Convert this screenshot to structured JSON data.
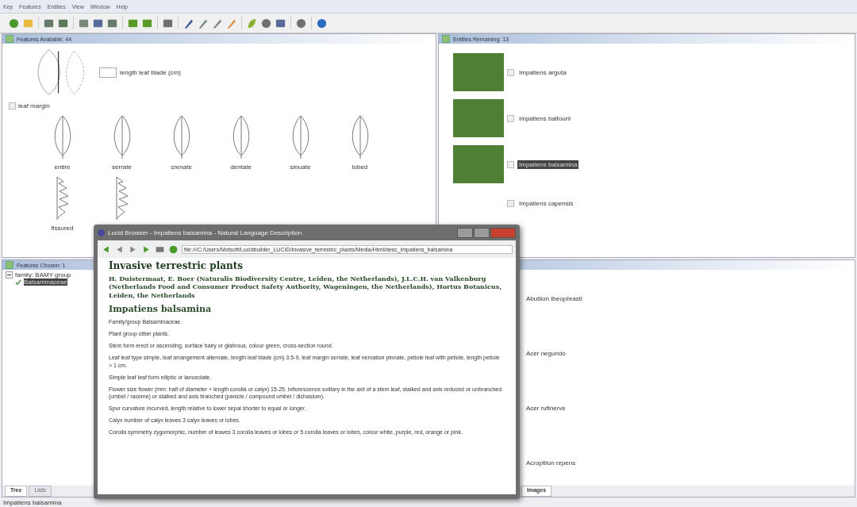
{
  "menu": [
    "Key",
    "Features",
    "Entities",
    "View",
    "Window",
    "Help"
  ],
  "features_available": {
    "title": "Features Available: 44",
    "length_field": {
      "label": "length leaf blade (cm)"
    },
    "leaf_margin": {
      "label": "leaf margin",
      "checked": false,
      "options": [
        {
          "label": "entire",
          "kind": "oval"
        },
        {
          "label": "serrate",
          "kind": "oval"
        },
        {
          "label": "crenate",
          "kind": "oval"
        },
        {
          "label": "dentate",
          "kind": "oval"
        },
        {
          "label": "sinuate",
          "kind": "oval"
        },
        {
          "label": "lobed",
          "kind": "oval"
        },
        {
          "label": "fissured",
          "kind": "fissured"
        },
        {
          "kind": "fissured"
        }
      ]
    }
  },
  "entities_remaining": {
    "title": "Entities Remaining: 13",
    "items": [
      {
        "name": "Impatiens arguta",
        "photo": true,
        "checked": false,
        "selected": false
      },
      {
        "name": "Impatiens balfourii",
        "photo": true,
        "checked": false,
        "selected": false
      },
      {
        "name": "Impatiens balsamina",
        "photo": true,
        "checked": false,
        "selected": true
      },
      {
        "name": "Impatiens capensis",
        "photo": false,
        "checked": false,
        "selected": false
      }
    ]
  },
  "features_chosen": {
    "title": "Features Chosen: 1",
    "tree": [
      {
        "label": "family: BAMY group",
        "expanded": true,
        "children": [
          {
            "label": "Balsaminaceae",
            "selected": true
          }
        ]
      }
    ],
    "tabs": [
      {
        "label": "Tree",
        "selected": true
      },
      {
        "label": "Lists",
        "selected": false
      }
    ]
  },
  "entities_discarded": {
    "items": [
      "Abutilon theophrasti",
      "Acer negundo",
      "Acer rufinerve",
      "Acroptilon repens"
    ],
    "tabs": [
      {
        "label": "Images",
        "selected": true
      }
    ]
  },
  "status_bar": "Impatiens balsamina",
  "browser": {
    "title": "Lucid Browser - Impatiens balsamina - Natural Language Description",
    "address": "file:///C:/Users/Motsoft/Lucidbuilder_LUCID/Invasive_terrestric_plants/Media/Html/desc_impatiens_balsamina",
    "heading": "Invasive terrestric plants",
    "authors": "H. Duistermaat, E. Boer (Naturalis Biodiversity Centre, Leiden, the Netherlands), J.L.C.H. van Valkenburg (Netherlands Food and Consumer Product Safety Authority, Wageningen, the Netherlands), Hortus Botanicus, Leiden, the Netherlands",
    "species": "Impatiens balsamina",
    "paragraphs": [
      "Family/group Balsaminaceae.",
      "Plant group other plants.",
      "Stem form erect or ascending, surface hairy or glabrous, colour green, cross-section round.",
      "Leaf leaf type simple, leaf arrangement alternate, length leaf blade (cm) 3.5-9, leaf margin serrate, leaf nervation pinnate, petiole leaf with petiole, length petiole > 1 cm.",
      "Simple leaf leaf form elliptic or lanceolate.",
      "Flower size flower (mm: half of diameter + length corolla or calyx) 15-25, inflorescence solitary in the axil of a stem leaf, stalked and axis reduced or unbranched (umbel / raceme) or stalked and axis branched (panicle / compound umbel / dichasium).",
      "Spur curvature incurved, length relative to lower sepal shorter to equal or longer.",
      "Calyx number of calyx leaves 3 calyx leaves or lobes.",
      "Corolla symmetry zygomorphic, number of leaves 3 corolla leaves or lobes or 5 corolla leaves or lobes, colour white, purple, red, orange or pink."
    ]
  }
}
